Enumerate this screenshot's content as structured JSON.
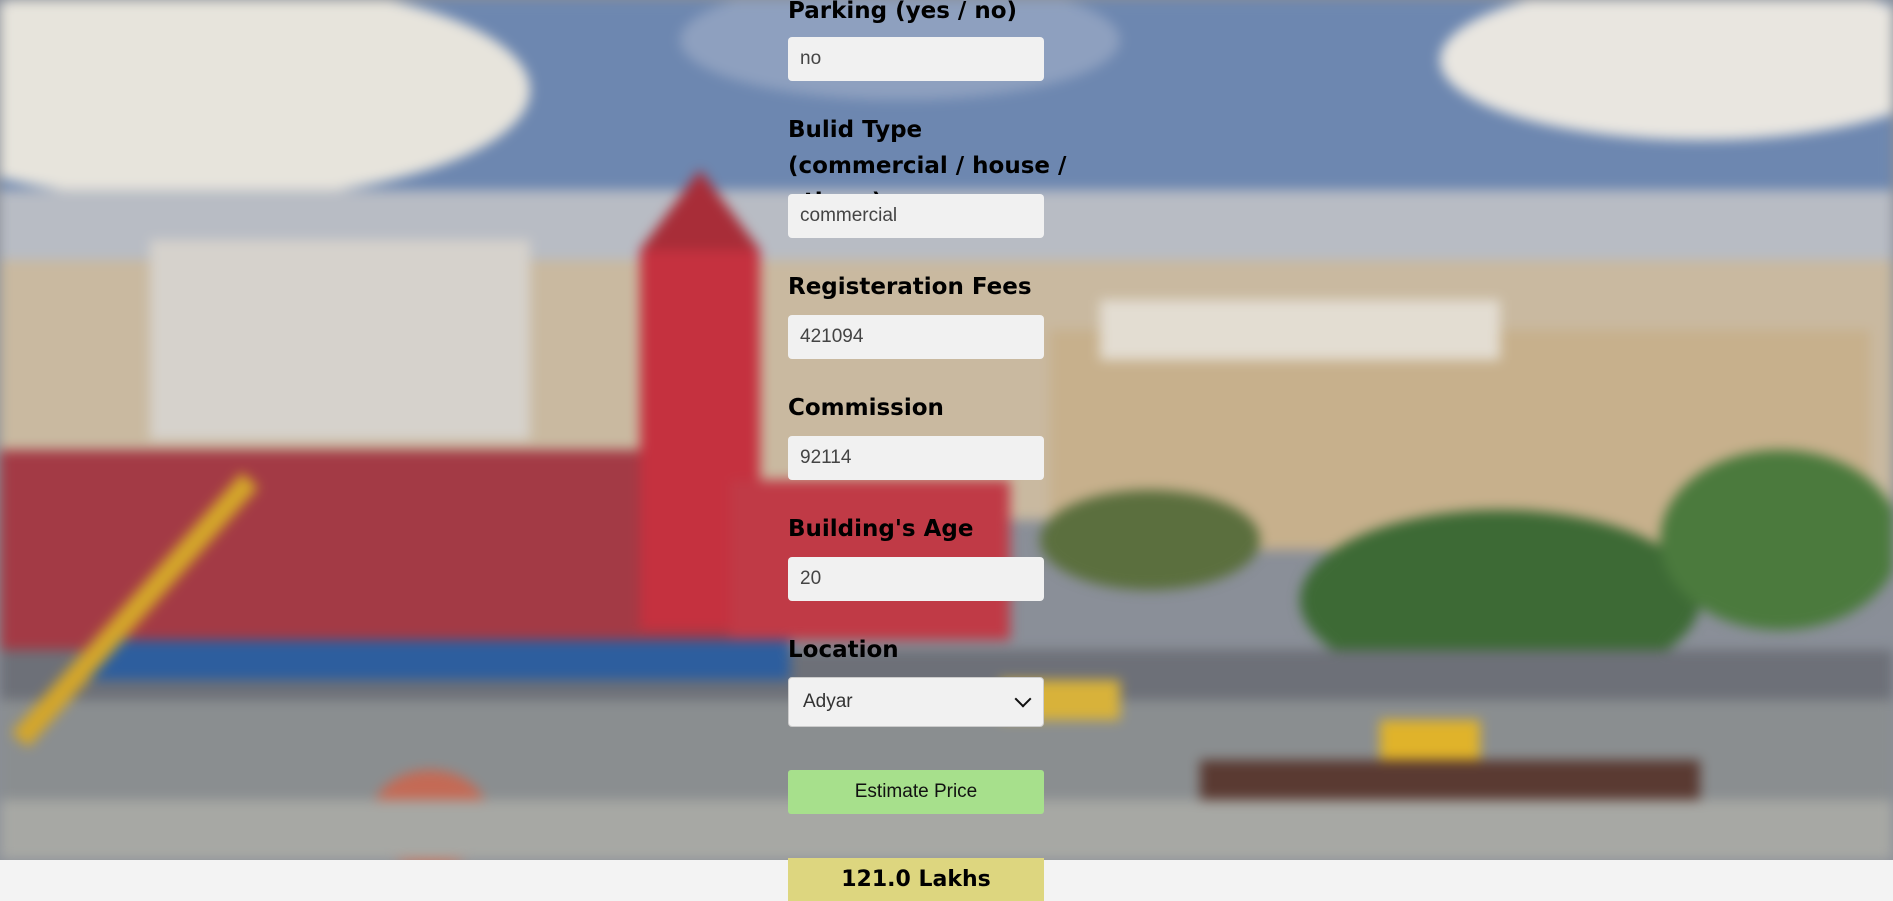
{
  "form": {
    "parking": {
      "label": "Parking (yes / no)",
      "value": "no"
    },
    "build_type": {
      "label": "Bulid Type (commercial / house / others)",
      "value": "commercial"
    },
    "registration_fees": {
      "label": "Registeration Fees",
      "value": "421094"
    },
    "commission": {
      "label": "Commission",
      "value": "92114"
    },
    "building_age": {
      "label": "Building's Age",
      "value": "20"
    },
    "location": {
      "label": "Location",
      "selected": "Adyar"
    },
    "estimate_button": "Estimate Price"
  },
  "result": "121.0 Lakhs",
  "colors": {
    "button": "#a7e08c",
    "result_bg": "#ddd67f",
    "input_bg": "#f1f1f1"
  }
}
